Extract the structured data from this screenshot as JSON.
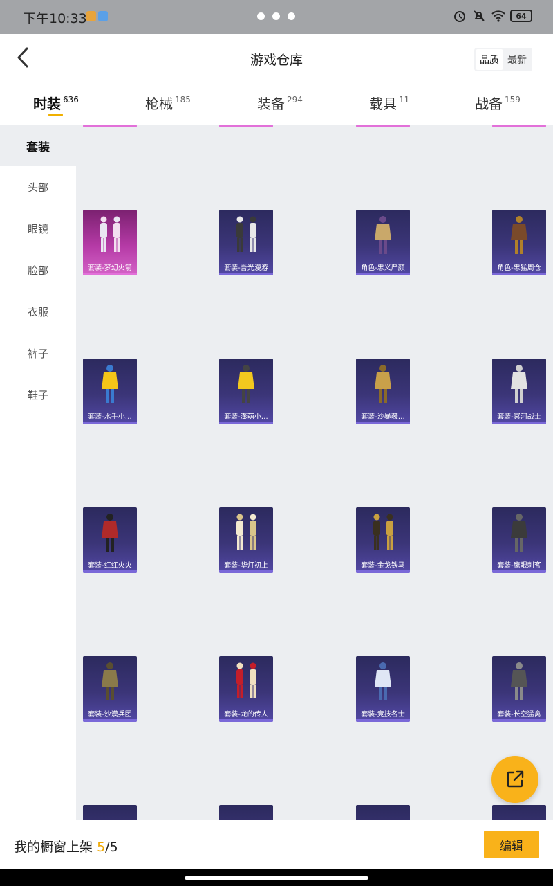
{
  "status": {
    "time": "下午10:33",
    "battery": "64"
  },
  "header": {
    "title": "游戏仓库",
    "sort": [
      "品质",
      "最新"
    ]
  },
  "tabs": [
    {
      "label": "时装",
      "count": "636",
      "active": true
    },
    {
      "label": "枪械",
      "count": "185"
    },
    {
      "label": "装备",
      "count": "294"
    },
    {
      "label": "载具",
      "count": "11"
    },
    {
      "label": "战备",
      "count": "159"
    }
  ],
  "sidebar": [
    "套装",
    "头部",
    "眼镜",
    "脸部",
    "衣服",
    "裤子",
    "鞋子"
  ],
  "items": [
    {
      "name": "套装-梦幻火箭",
      "style": "pink",
      "icon": "outfit-rocket"
    },
    {
      "name": "套装-吾光漫游",
      "style": "purple",
      "icon": "outfit-pair"
    },
    {
      "name": "角色-忠义严颜",
      "style": "purple",
      "icon": "character-general"
    },
    {
      "name": "角色-忠猛周仓",
      "style": "purple",
      "icon": "character-warrior"
    },
    {
      "name": "套装-水手小…",
      "style": "purple",
      "icon": "outfit-duck"
    },
    {
      "name": "套装-澎萌小…",
      "style": "purple",
      "icon": "outfit-yellow"
    },
    {
      "name": "套装-沙暴袭…",
      "style": "purple",
      "icon": "outfit-armor"
    },
    {
      "name": "套装-冥河战士",
      "style": "purple",
      "icon": "outfit-white"
    },
    {
      "name": "套装-红红火火",
      "style": "purple",
      "icon": "outfit-red-coat"
    },
    {
      "name": "套装-华灯初上",
      "style": "purple",
      "icon": "outfit-pair-white"
    },
    {
      "name": "套装-金戈铁马",
      "style": "purple",
      "icon": "outfit-pair-gold"
    },
    {
      "name": "套装-鹰眼刺客",
      "style": "purple",
      "icon": "outfit-camo-dark"
    },
    {
      "name": "套装-沙漠兵团",
      "style": "purple",
      "icon": "outfit-desert"
    },
    {
      "name": "套装-龙的传人",
      "style": "purple",
      "icon": "outfit-pair-red"
    },
    {
      "name": "套装-竞技名士",
      "style": "purple",
      "icon": "outfit-blue"
    },
    {
      "name": "套装-长空猛禽",
      "style": "purple",
      "icon": "outfit-camo-grey"
    }
  ],
  "footer": {
    "label": "我的橱窗上架",
    "shelf_current": "5",
    "shelf_sep": "/",
    "shelf_max": "5",
    "edit": "编辑"
  },
  "colors": {
    "accent": "#f9b21a",
    "item_bg": "#3b3578",
    "rare_bg": "#b53aa6",
    "content_bg": "#eceef1"
  }
}
